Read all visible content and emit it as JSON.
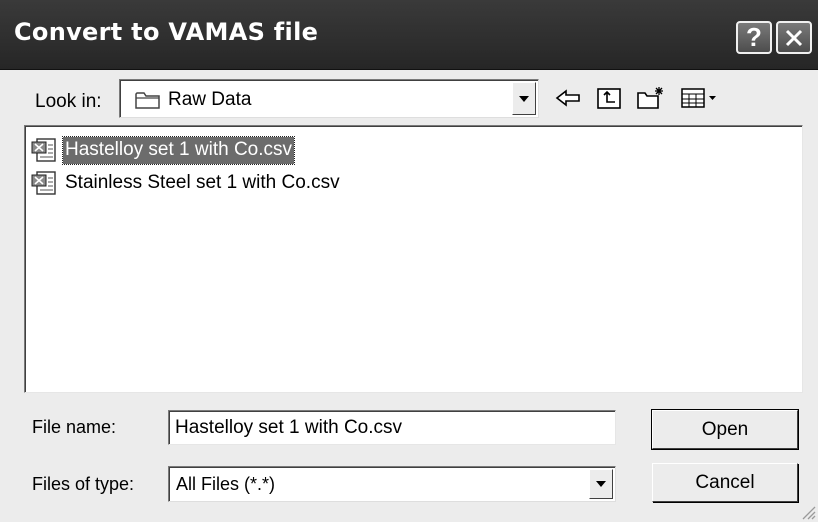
{
  "window": {
    "title": "Convert to VAMAS file",
    "help_label": "?",
    "close_icon": "close-x-icon"
  },
  "look_in": {
    "label": "Look in:",
    "value": "Raw Data",
    "folder_icon": "folder-icon"
  },
  "toolbar": {
    "icons": [
      "back-arrow-icon",
      "up-one-level-icon",
      "new-folder-icon",
      "view-menu-icon"
    ]
  },
  "files": [
    {
      "name": "Hastelloy set 1 with Co.csv",
      "selected": true,
      "icon": "csv-file-icon"
    },
    {
      "name": "Stainless Steel set 1 with Co.csv",
      "selected": false,
      "icon": "csv-file-icon"
    }
  ],
  "file_name": {
    "label": "File name:",
    "value": "Hastelloy set 1 with Co.csv"
  },
  "file_type": {
    "label": "Files of type:",
    "value": "All Files (*.*)"
  },
  "buttons": {
    "open": "Open",
    "cancel": "Cancel"
  },
  "colors": {
    "titlebar": "#2e2e2e",
    "selection": "#6c6c6c",
    "face": "#ececec"
  }
}
